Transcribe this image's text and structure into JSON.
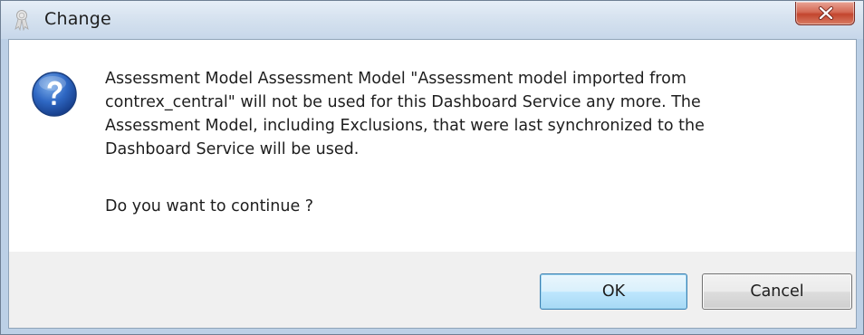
{
  "window": {
    "title": "Change",
    "icons": {
      "app": "ribbon-icon",
      "close": "close-icon",
      "message": "question-icon"
    }
  },
  "message": {
    "lines": [
      "Assessment Model Assessment Model \"Assessment model imported from",
      "contrex_central\" will not be used for this Dashboard Service any more. The",
      "Assessment Model, including Exclusions, that were last synchronized to the",
      "Dashboard Service will be used."
    ],
    "question": "Do you want to continue ?"
  },
  "buttons": {
    "ok_label": "OK",
    "cancel_label": "Cancel"
  },
  "colors": {
    "titlebar": "#d3e0ee",
    "close_button": "#c3452e",
    "button_band": "#f0f0f0",
    "default_button_border": "#3c7fb1"
  }
}
